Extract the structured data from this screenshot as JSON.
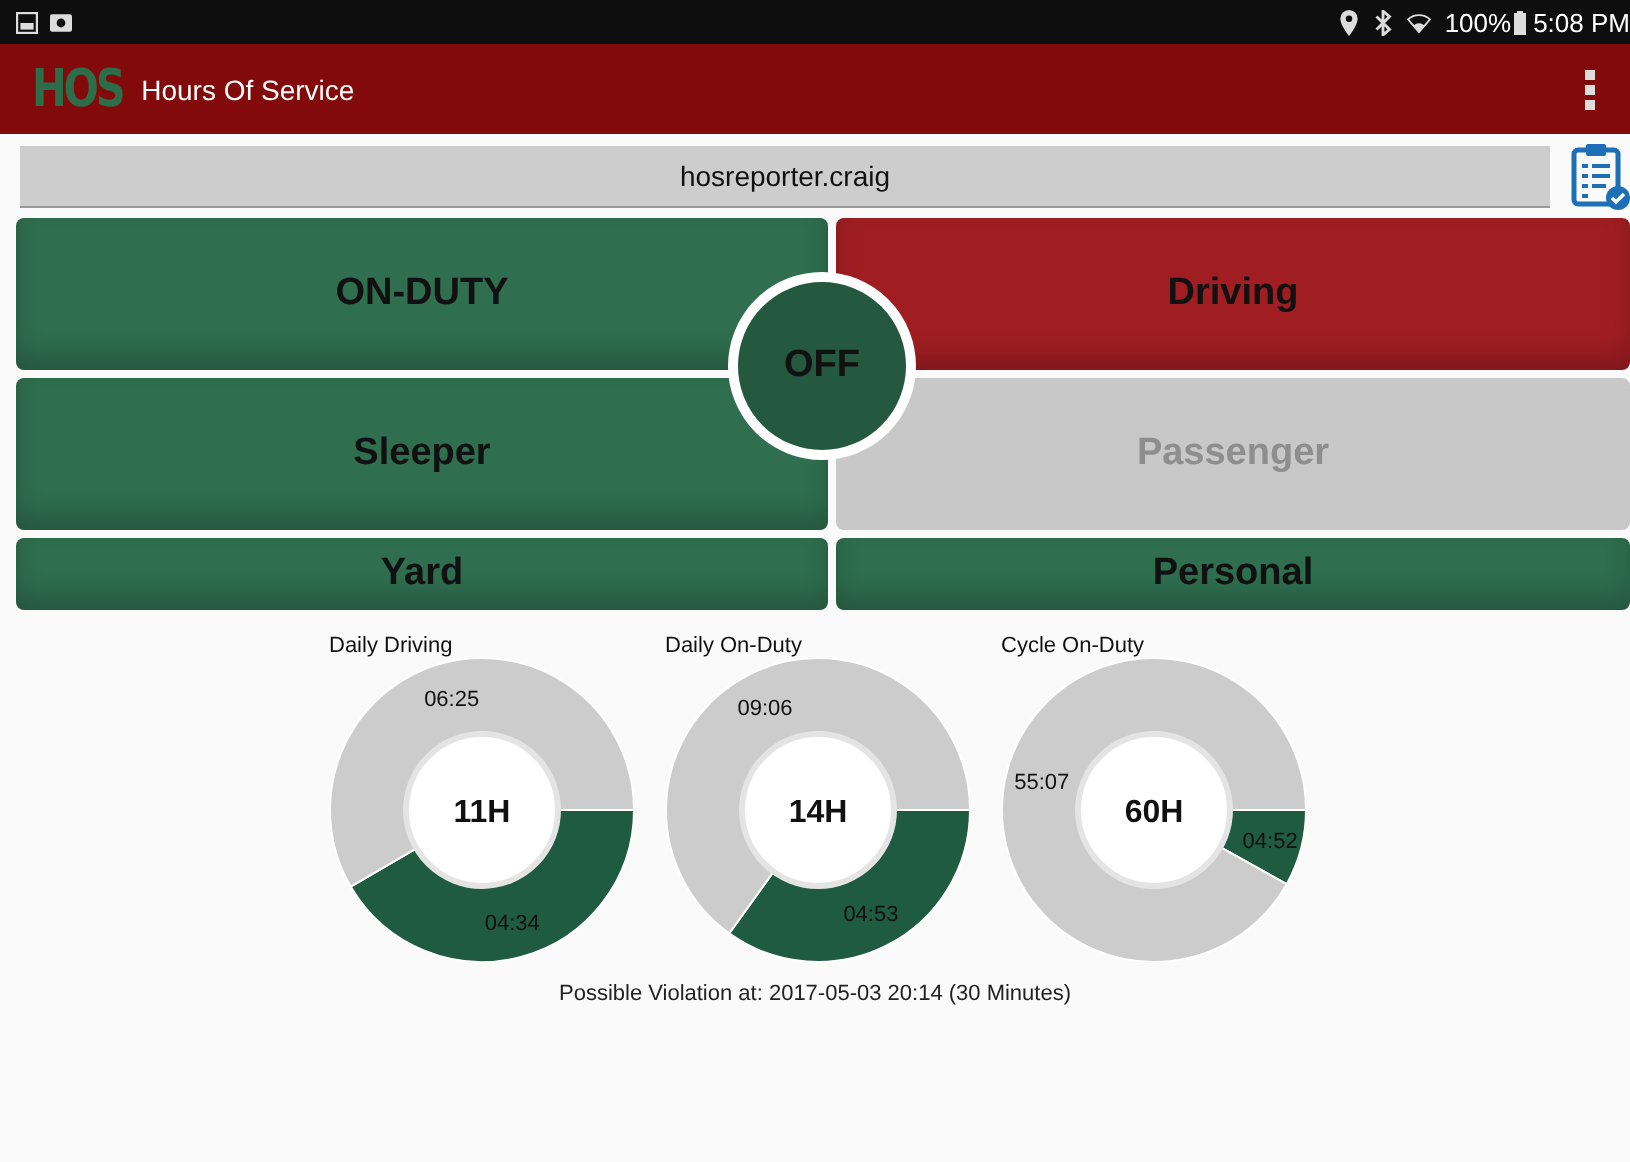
{
  "status_bar": {
    "battery": "100%",
    "time": "5:08 PM"
  },
  "app_bar": {
    "logo": "HOS",
    "title": "Hours Of Service"
  },
  "user": {
    "name": "hosreporter.craig"
  },
  "duty_buttons": [
    {
      "label": "ON-DUTY",
      "color": "#2f6e4f",
      "disabled": false
    },
    {
      "label": "Driving",
      "color": "#a01e22",
      "disabled": false
    },
    {
      "label": "Sleeper",
      "color": "#2f6e4f",
      "disabled": false
    },
    {
      "label": "Passenger",
      "color": "#c8c8c8",
      "disabled": true
    },
    {
      "label": "Yard",
      "color": "#2f6e4f",
      "disabled": false
    },
    {
      "label": "Personal",
      "color": "#2f6e4f",
      "disabled": false
    }
  ],
  "current_status": {
    "label": "OFF"
  },
  "gauges": [
    {
      "title": "Daily Driving",
      "center": "11H",
      "chart_data": {
        "type": "donut",
        "values": [
          274,
          385
        ],
        "value_labels": [
          "04:34",
          "06:25"
        ]
      }
    },
    {
      "title": "Daily On-Duty",
      "center": "14H",
      "chart_data": {
        "type": "donut",
        "values": [
          293,
          546
        ],
        "value_labels": [
          "04:53",
          "09:06"
        ]
      }
    },
    {
      "title": "Cycle On-Duty",
      "center": "60H",
      "chart_data": {
        "type": "donut",
        "values": [
          292,
          3307
        ],
        "value_labels": [
          "04:52",
          "55:07"
        ]
      }
    }
  ],
  "violation": "Possible Violation at: 2017-05-03 20:14  (30 Minutes)"
}
